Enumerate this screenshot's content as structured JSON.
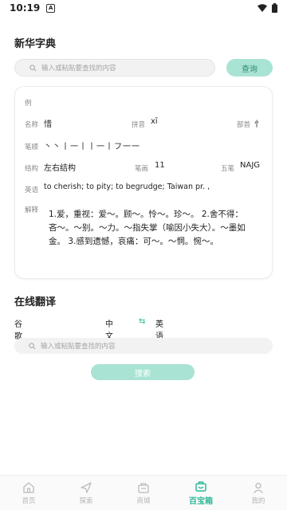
{
  "status": {
    "time": "10:19",
    "badge": "A"
  },
  "dictionary": {
    "title": "新华字典",
    "search_placeholder": "输入或粘贴要查找的内容",
    "query_button": "查询"
  },
  "card": {
    "example_label": "例",
    "name_label": "名称",
    "name_value": "惜",
    "pinyin_label": "拼音",
    "pinyin_value": "xī",
    "radical_label": "部首",
    "radical_value": "忄",
    "strokes_label": "笔顺",
    "strokes_value": "丶丶丨一丨丨一丨フ一一",
    "structure_label": "结构",
    "structure_value": "左右结构",
    "stroke_count_label": "笔画",
    "stroke_count_value": "11",
    "wubi_label": "五笔",
    "wubi_value": "NAJG",
    "english_label": "英语",
    "english_value": "to cherish; to pity; to begrudge; Taiwan pr. ,",
    "explain_label": "解释",
    "explain_value": "1.爱，重视：爱〜。顾〜。怜〜。珍〜。 2.舍不得：吝〜。〜别。〜力。〜指失掌（喻因小失大）。〜墨如金。 3.感到遗憾，哀痛：可〜。〜惘。惋〜。"
  },
  "translate": {
    "title": "在线翻译",
    "engine": "谷歌",
    "source_lang": "中文",
    "target_lang": "英语",
    "placeholder": "输入或粘贴要查找的内容",
    "search_button": "搜索"
  },
  "nav": {
    "items": [
      {
        "label": "首页",
        "icon": "home-icon",
        "active": false
      },
      {
        "label": "探索",
        "icon": "explore-icon",
        "active": false
      },
      {
        "label": "商城",
        "icon": "mall-icon",
        "active": false
      },
      {
        "label": "百宝箱",
        "icon": "toolbox-icon",
        "active": true
      },
      {
        "label": "我的",
        "icon": "profile-icon",
        "active": false
      }
    ]
  },
  "colors": {
    "accent": "#2fb89a",
    "accent_light": "#a9e3d3"
  }
}
